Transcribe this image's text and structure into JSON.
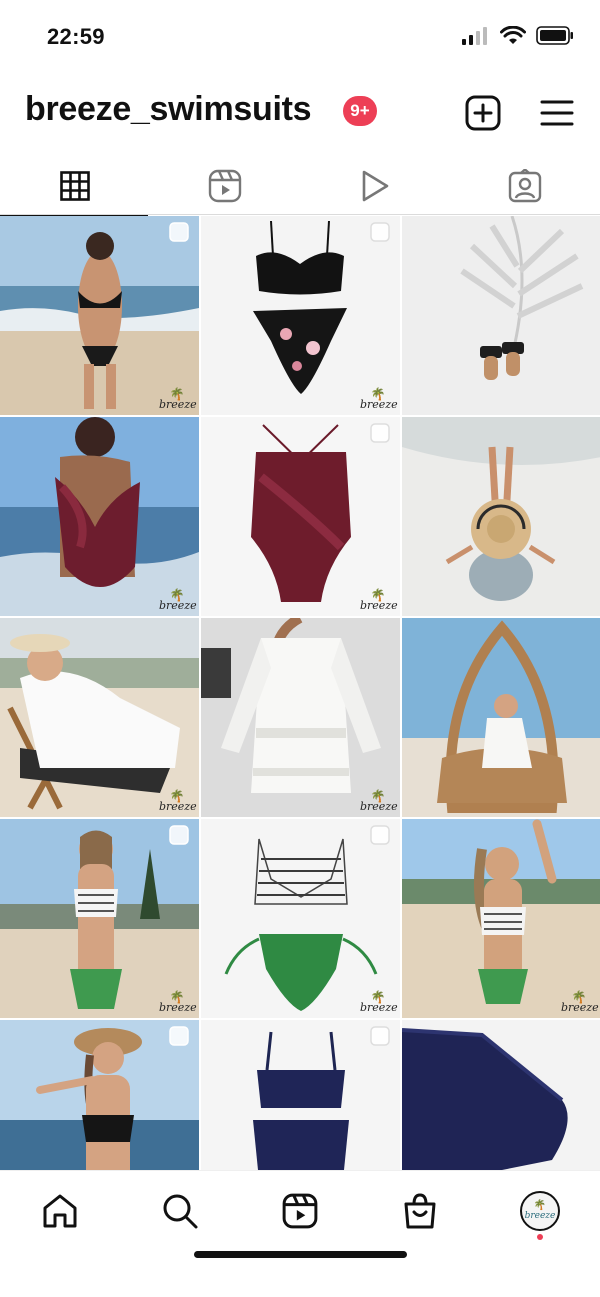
{
  "status_bar": {
    "time": "22:59",
    "signal_icon": "cellular-signal-icon",
    "wifi_icon": "wifi-icon",
    "battery_icon": "battery-icon"
  },
  "header": {
    "username": "breeze_swimsuits",
    "notification_badge": "9+",
    "create_icon": "plus-square-icon",
    "menu_icon": "hamburger-menu-icon"
  },
  "tabs": [
    {
      "name": "posts-grid",
      "icon": "grid-icon",
      "active": true
    },
    {
      "name": "reels",
      "icon": "reels-icon",
      "active": false
    },
    {
      "name": "videos",
      "icon": "play-icon",
      "active": false
    },
    {
      "name": "tagged",
      "icon": "tagged-person-icon",
      "active": false
    }
  ],
  "posts": [
    {
      "name": "post-woman-black-bikini-beach",
      "multi_image": true,
      "brand_mark": "breeze"
    },
    {
      "name": "post-black-bikini-flatlay",
      "multi_image": true,
      "brand_mark": "breeze"
    },
    {
      "name": "post-sandals-palm-shadow",
      "multi_image": false,
      "brand_mark": ""
    },
    {
      "name": "post-woman-burgundy-one-piece",
      "multi_image": false,
      "brand_mark": "breeze"
    },
    {
      "name": "post-burgundy-one-piece-flatlay",
      "multi_image": true,
      "brand_mark": "breeze"
    },
    {
      "name": "post-woman-sun-hat-sand",
      "multi_image": false,
      "brand_mark": ""
    },
    {
      "name": "post-woman-white-coverup-chair",
      "multi_image": false,
      "brand_mark": "breeze"
    },
    {
      "name": "post-white-coverup-dress",
      "multi_image": false,
      "brand_mark": "breeze"
    },
    {
      "name": "post-woman-rattan-chair",
      "multi_image": false,
      "brand_mark": ""
    },
    {
      "name": "post-woman-striped-green-bikini",
      "multi_image": true,
      "brand_mark": "breeze"
    },
    {
      "name": "post-striped-green-bikini-flatlay",
      "multi_image": true,
      "brand_mark": "breeze"
    },
    {
      "name": "post-woman-striped-green-bikini-beach",
      "multi_image": false,
      "brand_mark": "breeze"
    },
    {
      "name": "post-woman-straw-hat-black-bikini",
      "multi_image": true,
      "brand_mark": ""
    },
    {
      "name": "post-navy-bikini-flatlay",
      "multi_image": true,
      "brand_mark": ""
    },
    {
      "name": "post-navy-fabric-closeup",
      "multi_image": false,
      "brand_mark": ""
    }
  ],
  "bottom_nav": [
    {
      "name": "nav-home",
      "icon": "home-icon"
    },
    {
      "name": "nav-search",
      "icon": "search-icon"
    },
    {
      "name": "nav-reels",
      "icon": "reels-icon"
    },
    {
      "name": "nav-shop",
      "icon": "shopping-bag-icon"
    },
    {
      "name": "nav-profile",
      "icon": "profile-avatar-icon"
    }
  ],
  "profile_avatar_text": "breeze",
  "colors": {
    "badge": "#ed3f56",
    "text": "#111111",
    "divider": "#dbdbdb"
  }
}
